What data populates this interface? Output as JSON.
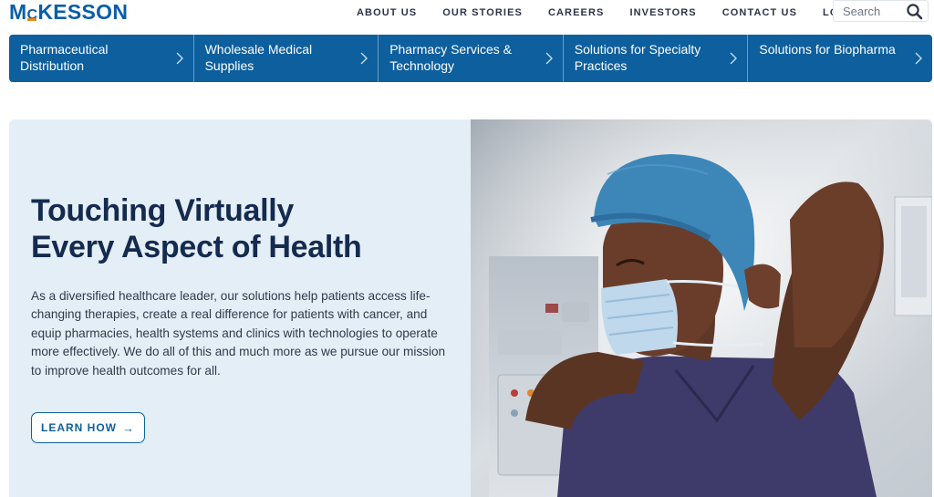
{
  "brand": {
    "logo_text_pre": "M",
    "logo_text_c": "C",
    "logo_text_post": "KESSON",
    "color_primary": "#0d5f9e",
    "color_accent": "#e38b1b"
  },
  "topnav": {
    "items": [
      "ABOUT US",
      "OUR STORIES",
      "CAREERS",
      "INVESTORS",
      "CONTACT US",
      "LOGINS"
    ]
  },
  "search": {
    "placeholder": "Search",
    "icon": "search-icon"
  },
  "categories": [
    {
      "label": "Pharmaceutical Distribution"
    },
    {
      "label": "Wholesale Medical Supplies"
    },
    {
      "label": "Pharmacy Services & Technology"
    },
    {
      "label": "Solutions for Specialty Practices"
    },
    {
      "label": "Solutions for Biopharma"
    }
  ],
  "hero": {
    "headline_line1": "Touching Virtually",
    "headline_line2": "Every Aspect of Health",
    "body": "As a diversified healthcare leader, our solutions help patients access life-changing therapies, create a real difference for patients with cancer, and equip pharmacies, health systems and clinics with technologies to operate more effectively. We do all of this and much more as we pursue our mission to improve health outcomes for all.",
    "cta_label": "LEARN HOW",
    "cta_arrow": "→",
    "background_color": "#e4eef6"
  }
}
